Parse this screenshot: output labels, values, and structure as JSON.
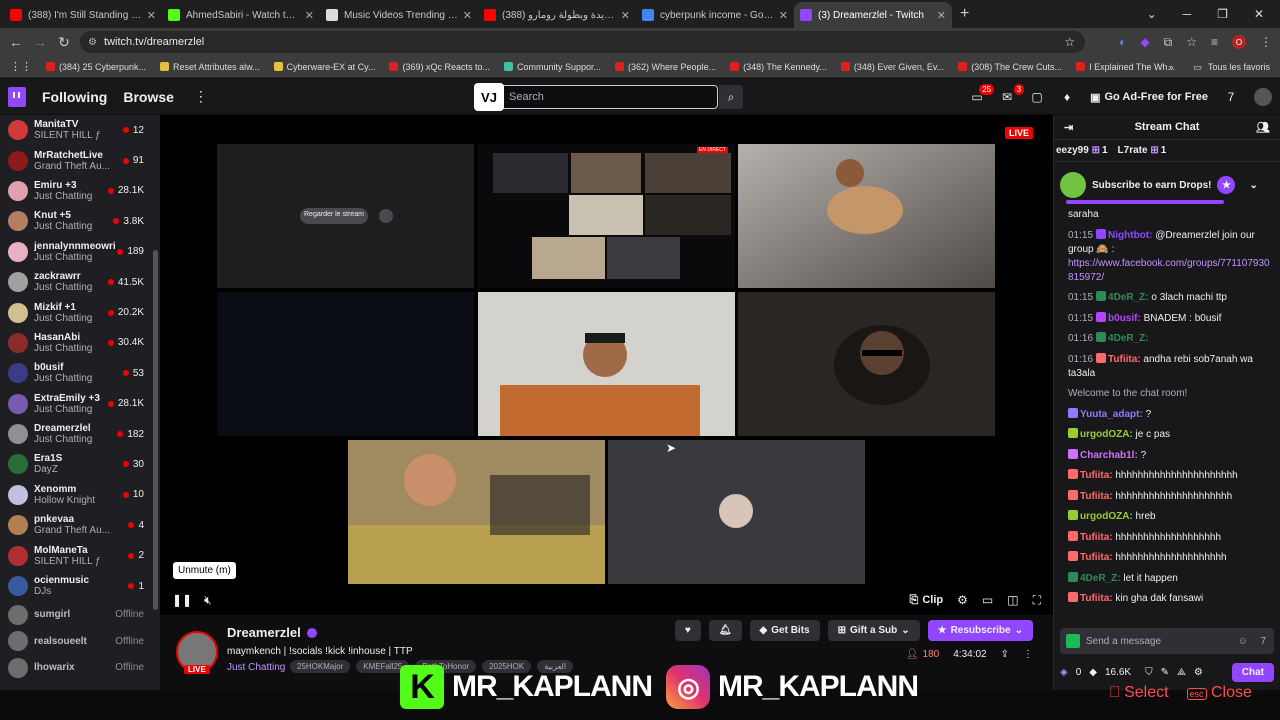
{
  "browser": {
    "tabs": [
      {
        "title": "(388) I'm Still Standing - YouTube",
        "color": "#ff0000",
        "active": false
      },
      {
        "title": "AhmedSabiri - Watch the VOD",
        "color": "#53fc18",
        "active": false
      },
      {
        "title": "Music Videos Trending in Morocco",
        "color": "#dddddd",
        "active": false
      },
      {
        "title": "(388) اخبار جديدة وبطولة رومارو",
        "color": "#ff0000",
        "active": false
      },
      {
        "title": "cyberpunk income - Google Search",
        "color": "#4285f4",
        "active": false
      },
      {
        "title": "(3) Dreamerzlel - Twitch",
        "color": "#9147ff",
        "active": true
      }
    ],
    "url": "twitch.tv/dreamerzlel",
    "profile_letter": "O",
    "bookmarks": [
      "(384) 25 Cyberpunk...",
      "Reset Attributes alw...",
      "Cyberware-EX at Cy...",
      "(369) xQc Reacts to...",
      "Community Suppor...",
      "(362) Where People...",
      "(348) The Kennedy...",
      "(348) Ever Given, Ev...",
      "(308) The Crew Cuts...",
      "I Explained The Wh..."
    ],
    "all_bookmarks": "Tous les favoris"
  },
  "twitch": {
    "nav": {
      "following": "Following",
      "browse": "Browse",
      "search_placeholder": "Search",
      "vj_logo": "VJ",
      "notif_count": "25",
      "inbox_count": "3",
      "adfree": "Go Ad-Free for Free"
    },
    "sidebar": [
      {
        "name": "ManitaTV",
        "game": "SILENT HILL ƒ",
        "viewers": "12",
        "color": "#d13a3a"
      },
      {
        "name": "MrRatchetLive",
        "game": "Grand Theft Au...",
        "viewers": "91",
        "color": "#8b1a1a"
      },
      {
        "name": "Emiru +3",
        "game": "Just Chatting",
        "viewers": "28.1K",
        "color": "#e0a0b0"
      },
      {
        "name": "Knut +5",
        "game": "Just Chatting",
        "viewers": "3.8K",
        "color": "#b08060"
      },
      {
        "name": "jennalynnmeowri",
        "game": "Just Chatting",
        "viewers": "189",
        "color": "#e8b0c0"
      },
      {
        "name": "zackrawrr",
        "game": "Just Chatting",
        "viewers": "41.5K",
        "color": "#a0a0a0"
      },
      {
        "name": "Mizkif +1",
        "game": "Just Chatting",
        "viewers": "20.2K",
        "color": "#d0c090"
      },
      {
        "name": "HasanAbi",
        "game": "Just Chatting",
        "viewers": "30.4K",
        "color": "#8a2c2c"
      },
      {
        "name": "b0usif",
        "game": "Just Chatting",
        "viewers": "53",
        "color": "#3b3b8a"
      },
      {
        "name": "ExtraEmily +3",
        "game": "Just Chatting",
        "viewers": "28.1K",
        "color": "#7a5ab0"
      },
      {
        "name": "Dreamerzlel",
        "game": "Just Chatting",
        "viewers": "182",
        "color": "#909090"
      },
      {
        "name": "Era1S",
        "game": "DayZ",
        "viewers": "30",
        "color": "#2d6b3a"
      },
      {
        "name": "Xenomm",
        "game": "Hollow Knight",
        "viewers": "10",
        "color": "#c0c0e0"
      },
      {
        "name": "pnkevaa",
        "game": "Grand Theft Au...",
        "viewers": "4",
        "color": "#b08050"
      },
      {
        "name": "MolManeTa",
        "game": "SILENT HILL ƒ",
        "viewers": "2",
        "color": "#b03030"
      },
      {
        "name": "ocienmusic",
        "game": "DJs",
        "viewers": "1",
        "color": "#3a5aa0"
      }
    ],
    "offline": [
      {
        "name": "sumgirl",
        "status": "Offline"
      },
      {
        "name": "realsoueelt",
        "status": "Offline"
      },
      {
        "name": "lhowarix",
        "status": "Offline"
      }
    ],
    "player": {
      "live_label": "LIVE",
      "tooltip": "Unmute (m)",
      "clip_label": "Clip",
      "watch_stream": "Regarder le stream",
      "en_direct": "EN DIRECT"
    },
    "stream": {
      "streamer": "Dreamerzlel",
      "title": "maymkench | !socials !kick !inhouse | TTP",
      "category": "Just Chatting",
      "tags": [
        "25HOKMajor",
        "KMEFall25",
        "PathToHonor",
        "2025HOK",
        "العربية"
      ],
      "live_tag": "LIVE",
      "viewers": "180",
      "uptime": "4:34:02",
      "get_bits": "Get Bits",
      "gift_sub": "Gift a Sub",
      "resubscribe": "Resubscribe"
    },
    "chat": {
      "header": "Stream Chat",
      "gifters": [
        {
          "name": "eezy99",
          "count": "1"
        },
        {
          "name": "L7rate",
          "count": "1"
        }
      ],
      "drops": "Subscribe to earn Drops!",
      "messages": [
        {
          "ts": "",
          "user": "",
          "text": "saraha",
          "color": "#efeff1"
        },
        {
          "ts": "01:15",
          "user": "Nightbot:",
          "text": "@Dreamerzlel join our group 🙈 :",
          "link": "https://www.facebook.com/groups/771107930815972/",
          "color": "#9147ff"
        },
        {
          "ts": "01:15",
          "user": "4DeR_Z:",
          "text": "o 3lach machi ttp",
          "color": "#2e8b57"
        },
        {
          "ts": "01:15",
          "user": "b0usif:",
          "text": "BNADEM : b0usif",
          "color": "#b744ff"
        },
        {
          "ts": "01:16",
          "user": "4DeR_Z:",
          "text": "",
          "color": "#2e8b57"
        },
        {
          "ts": "01:16",
          "user": "Tufiita:",
          "text": "andha rebi sob7anah wa ta3ala",
          "color": "#ff6b6b"
        }
      ],
      "welcome": "Welcome to the chat room!",
      "messages2": [
        {
          "user": "Yuuta_adapt:",
          "text": "?",
          "color": "#8a7cff"
        },
        {
          "user": "urgodOZA:",
          "text": "je c pas",
          "color": "#9acd32"
        },
        {
          "user": "Charchab1l:",
          "text": "?",
          "color": "#d070ff"
        },
        {
          "user": "Tufiita:",
          "text": "hhhhhhhhhhhhhhhhhhhhhh",
          "color": "#ff6b6b"
        },
        {
          "user": "Tufiita:",
          "text": "hhhhhhhhhhhhhhhhhhhhh",
          "color": "#ff6b6b"
        },
        {
          "user": "urgodOZA:",
          "text": "hreb",
          "color": "#9acd32"
        },
        {
          "user": "Tufiita:",
          "text": "hhhhhhhhhhhhhhhhhhh",
          "color": "#ff6b6b"
        },
        {
          "user": "Tufiita:",
          "text": "hhhhhhhhhhhhhhhhhhhh",
          "color": "#ff6b6b"
        },
        {
          "user": "4DeR_Z:",
          "text": "let it happen",
          "color": "#2e8b57"
        },
        {
          "user": "Tufiita:",
          "text": "kin gha dak fansawi",
          "color": "#ff6b6b"
        }
      ],
      "input_placeholder": "Send a message",
      "points": "0",
      "points2": "16.6K",
      "chat_button": "Chat"
    }
  },
  "overlay": {
    "kick_handle": "MR_KAPLANN",
    "ig_handle": "MR_KAPLANN",
    "kick_letter": "K",
    "select_label": "Select",
    "close_label": "Close",
    "esc_key": "esc"
  }
}
